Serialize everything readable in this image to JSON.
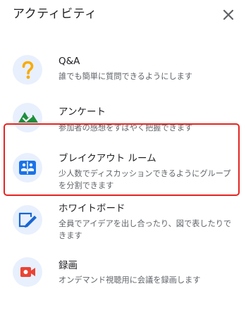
{
  "panel": {
    "title": "アクティビティ",
    "close_icon": "close-icon"
  },
  "activities": [
    {
      "title": "Q&A",
      "description": "誰でも簡単に質問できるようにします",
      "icon": "question-mark-icon",
      "icon_color": "#f9ab00"
    },
    {
      "title": "アンケート",
      "description": "参加者の感想をすばやく把握できます",
      "icon": "poll-icon",
      "icon_color": "#1e8e3e"
    },
    {
      "title": "ブレイクアウト ルーム",
      "description": "少人数でディスカッションできるようにグループを分割できます",
      "icon": "breakout-rooms-icon",
      "icon_color": "#1a73e8",
      "highlighted": true
    },
    {
      "title": "ホワイトボード",
      "description": "全員でアイデアを出し合ったり、図で表したりできます",
      "icon": "whiteboard-icon",
      "icon_color": "#1967d2"
    },
    {
      "title": "録画",
      "description": "オンデマンド視聴用に会議を録画します",
      "icon": "record-icon",
      "icon_color": "#ea4335"
    }
  ],
  "colors": {
    "highlight_border": "#e52421",
    "icon_background": "#e8f0fe"
  }
}
